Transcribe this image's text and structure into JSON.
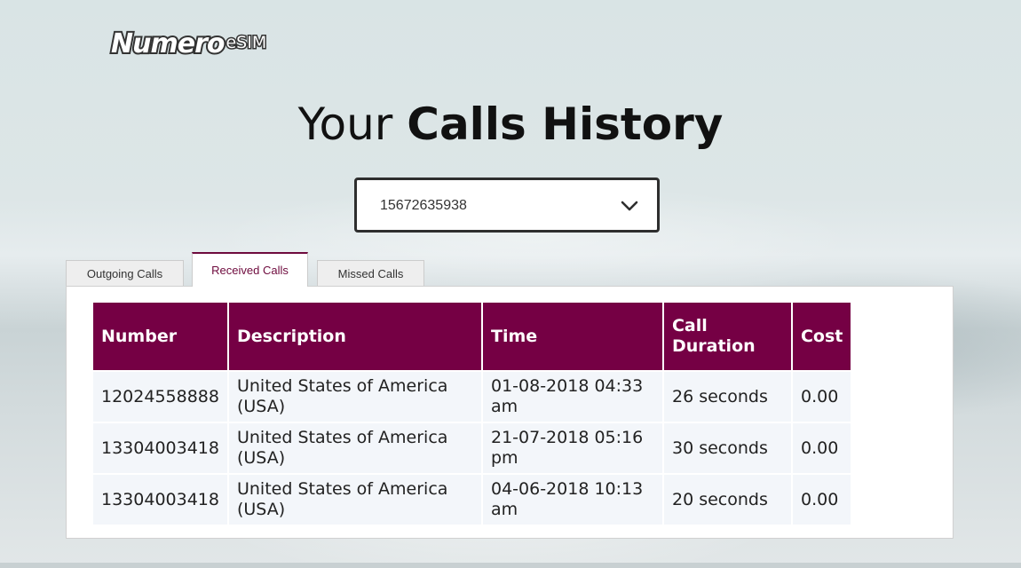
{
  "brand": {
    "logo_word": "Numero",
    "logo_suffix": "eSIM"
  },
  "page": {
    "title_light": "Your ",
    "title_bold": "Calls History"
  },
  "number_select": {
    "selected": "15672635938",
    "icon": "chevron-down-icon"
  },
  "tabs": [
    {
      "label": "Outgoing Calls",
      "active": false
    },
    {
      "label": "Received Calls",
      "active": true
    },
    {
      "label": "Missed Calls",
      "active": false
    }
  ],
  "table": {
    "headers": [
      "Number",
      "Description",
      "Time",
      "Call Duration",
      "Cost"
    ],
    "rows": [
      {
        "number": "12024558888",
        "description": "United States of America (USA)",
        "time": "01-08-2018 04:33 am",
        "duration": "26 seconds",
        "cost": "0.00"
      },
      {
        "number": "13304003418",
        "description": "United States of America (USA)",
        "time": "21-07-2018 05:16 pm",
        "duration": "30 seconds",
        "cost": "0.00"
      },
      {
        "number": "13304003418",
        "description": "United States of America (USA)",
        "time": "04-06-2018 10:13 am",
        "duration": "20 seconds",
        "cost": "0.00"
      }
    ]
  },
  "colors": {
    "accent": "#750044",
    "row_bg": "#f3f6fa"
  }
}
